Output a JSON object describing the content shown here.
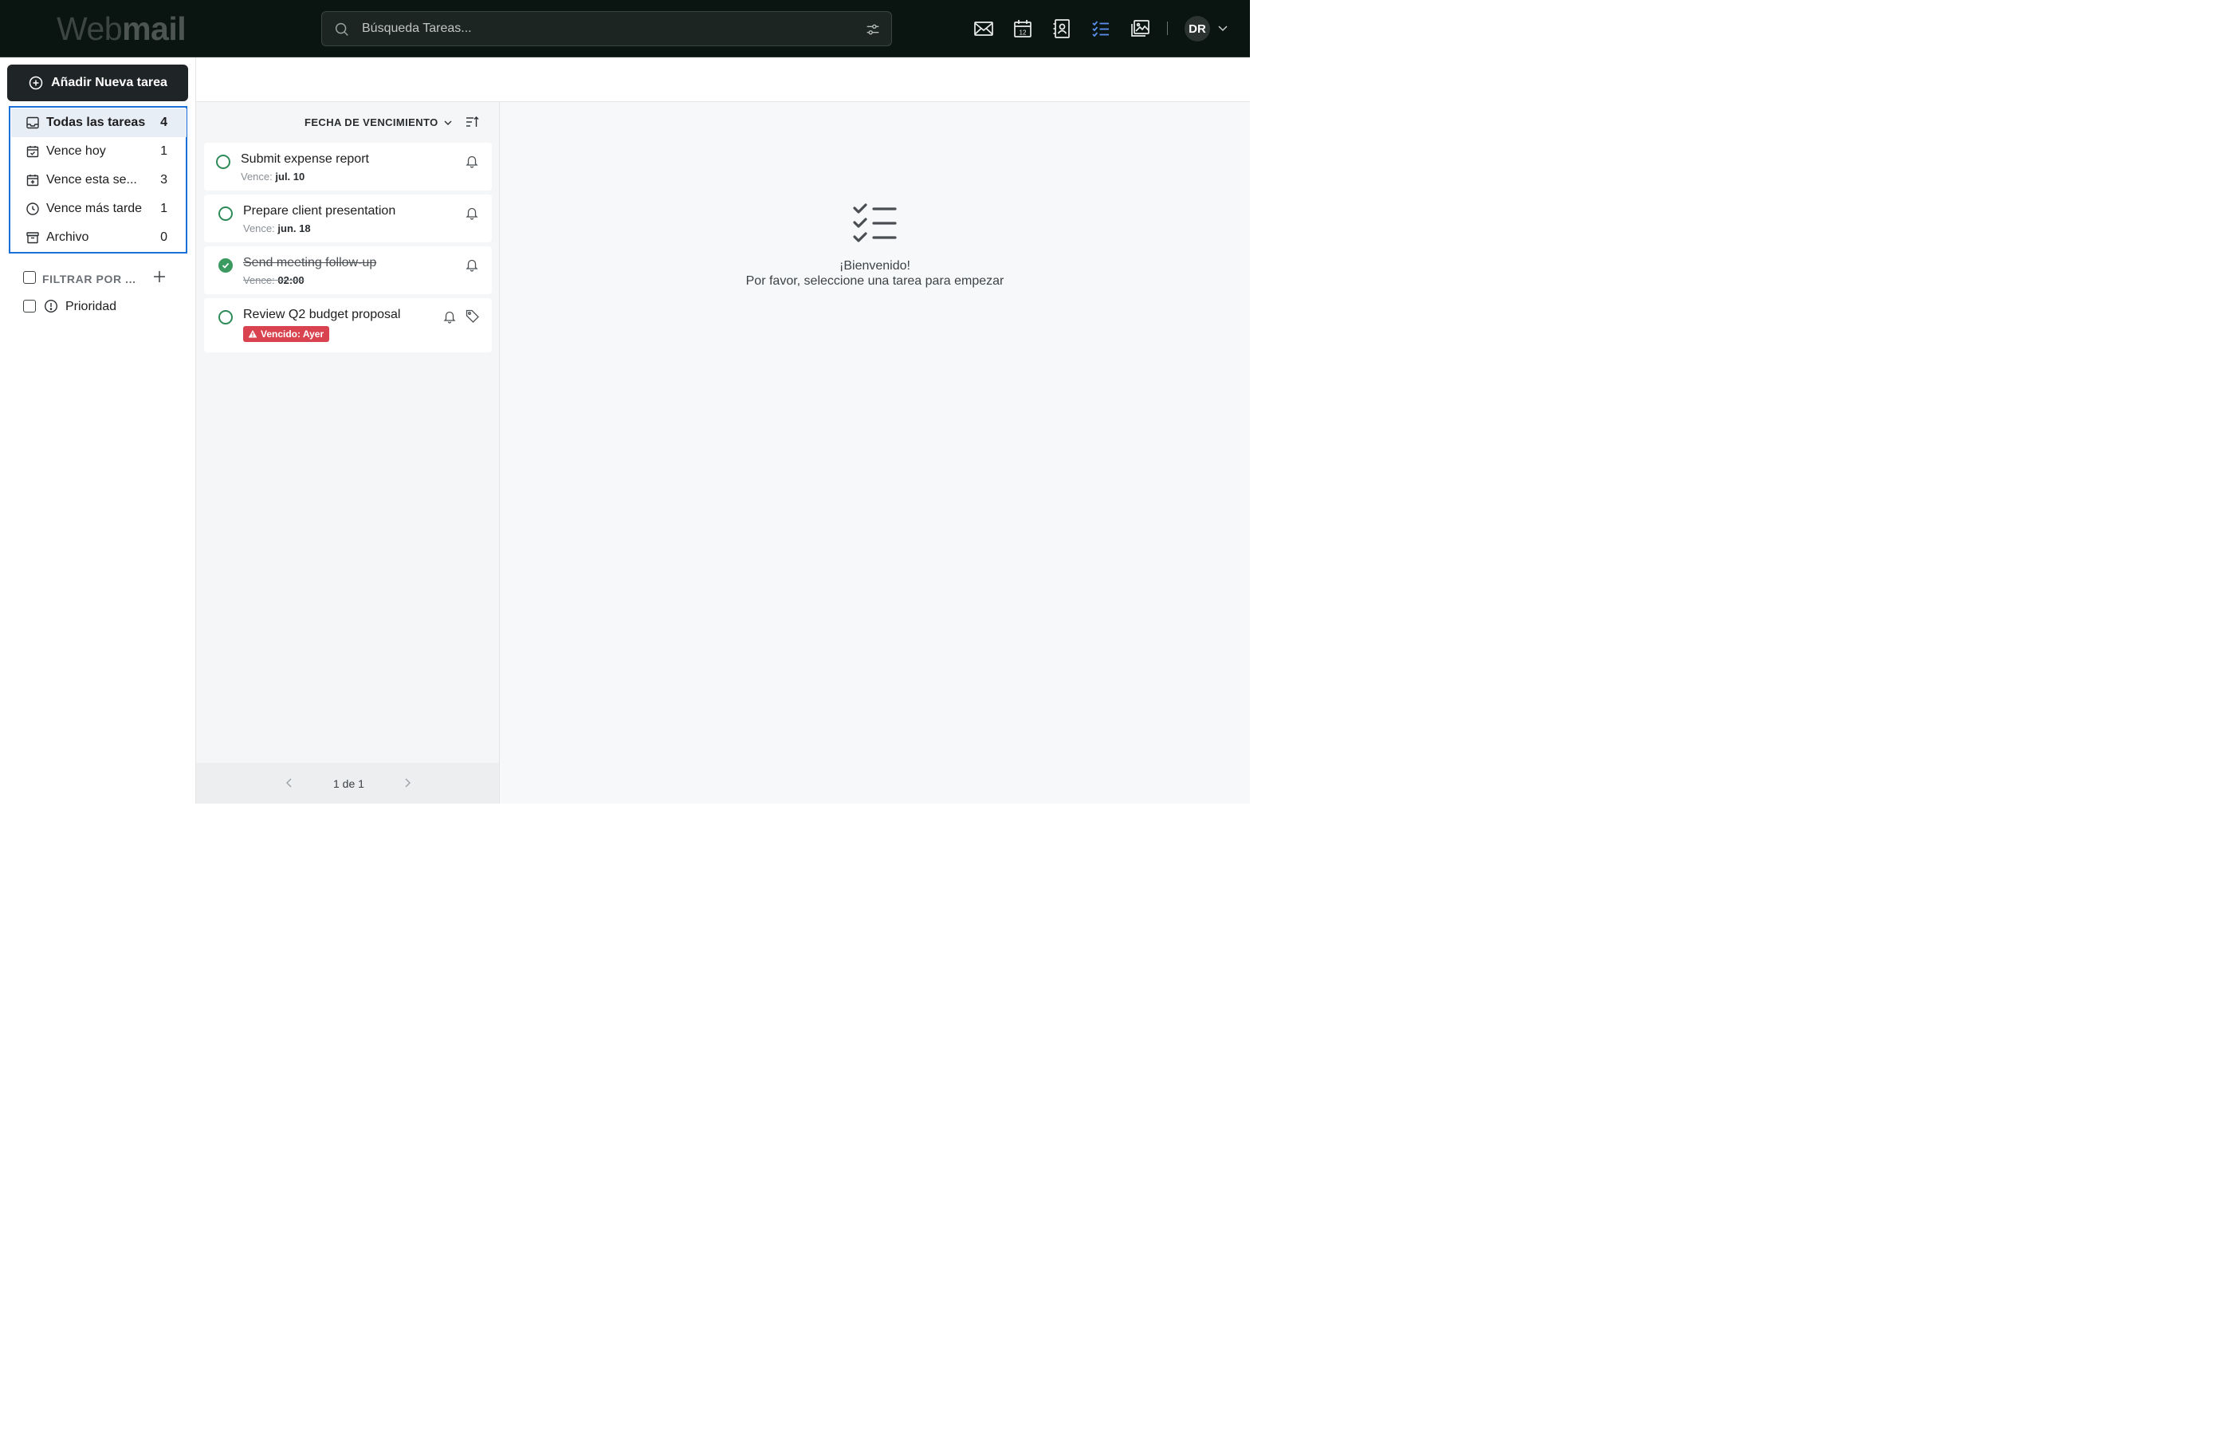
{
  "app": {
    "logo_part1": "Web",
    "logo_part2": "mail"
  },
  "search": {
    "placeholder": "Búsqueda Tareas..."
  },
  "header_icons": [
    "mail-icon",
    "calendar-icon",
    "contacts-icon",
    "tasks-icon",
    "photos-icon"
  ],
  "user": {
    "initials": "DR"
  },
  "sidebar": {
    "add_button": "Añadir Nueva tarea",
    "items": [
      {
        "label": "Todas las tareas",
        "count": "4",
        "icon": "inbox-icon",
        "active": true
      },
      {
        "label": "Vence hoy",
        "count": "1",
        "icon": "calendar-check-icon",
        "active": false
      },
      {
        "label": "Vence esta se...",
        "count": "3",
        "icon": "calendar-plus-icon",
        "active": false
      },
      {
        "label": "Vence más tarde",
        "count": "1",
        "icon": "clock-icon",
        "active": false
      },
      {
        "label": "Archivo",
        "count": "0",
        "icon": "archive-icon",
        "active": false
      }
    ],
    "filter_label": "FILTRAR POR ...",
    "filters": [
      {
        "label": "Prioridad",
        "icon": "alert-circle-icon"
      }
    ]
  },
  "list": {
    "sort_label": "FECHA DE VENCIMIENTO",
    "tasks": [
      {
        "title": "Submit expense report",
        "due_prefix": "Vence:",
        "due_value": "jul. 10",
        "completed": false,
        "has_tag": false
      },
      {
        "title": "Prepare client presentation",
        "due_prefix": "Vence:",
        "due_value": "jun. 18",
        "completed": false,
        "has_tag": false
      },
      {
        "title": "Send meeting follow-up",
        "due_prefix": "Vence:",
        "due_value": "02:00",
        "completed": true,
        "has_tag": false
      },
      {
        "title": "Review Q2 budget proposal",
        "overdue_label": "Vencido: Ayer",
        "completed": false,
        "has_tag": true
      }
    ],
    "pagination": "1 de 1"
  },
  "detail": {
    "welcome_title": "¡Bienvenido!",
    "welcome_text": "Por favor, seleccione una tarea para empezar"
  },
  "colors": {
    "header_bg": "#0a1411",
    "accent": "#1a6fd8",
    "task_circle": "#2e8b57",
    "overdue": "#d9434f",
    "tasks_icon_active": "#4a7fe0"
  }
}
